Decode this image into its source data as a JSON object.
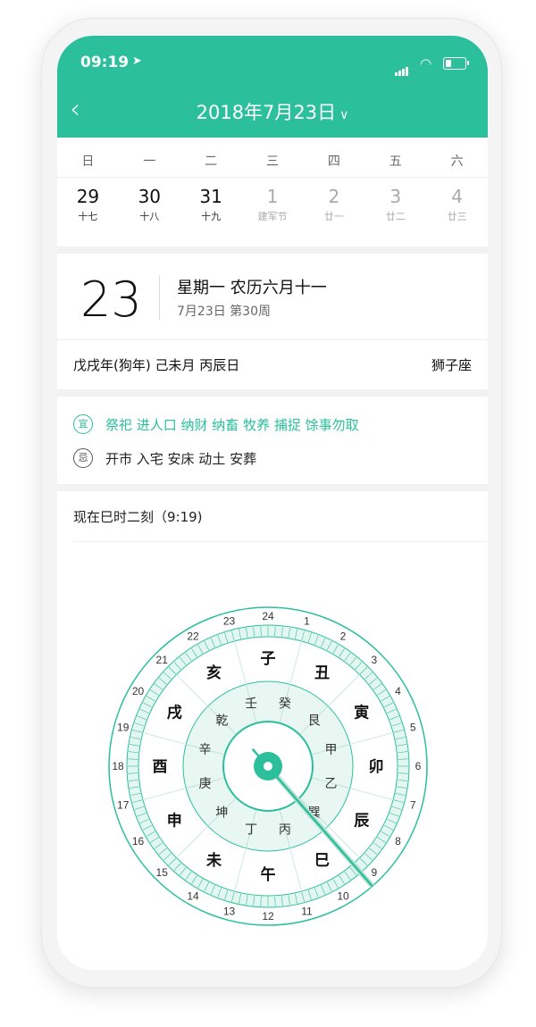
{
  "status": {
    "time": "09:19"
  },
  "header": {
    "title": "2018年7月23日"
  },
  "week": {
    "headers": [
      "日",
      "一",
      "二",
      "三",
      "四",
      "五",
      "六"
    ],
    "days": [
      {
        "num": "29",
        "lunar": "十七",
        "dim": false
      },
      {
        "num": "30",
        "lunar": "十八",
        "dim": false
      },
      {
        "num": "31",
        "lunar": "十九",
        "dim": false
      },
      {
        "num": "1",
        "lunar": "建军节",
        "dim": true
      },
      {
        "num": "2",
        "lunar": "廿一",
        "dim": true
      },
      {
        "num": "3",
        "lunar": "廿二",
        "dim": true
      },
      {
        "num": "4",
        "lunar": "廿三",
        "dim": true
      }
    ]
  },
  "detail": {
    "day": "23",
    "weekday_lunar": "星期一 农历六月十一",
    "sub": "7月23日 第30周",
    "ganzhi": "戊戌年(狗年) 己未月 丙辰日",
    "zodiac": "狮子座"
  },
  "yiji": {
    "yi_badge": "宜",
    "yi_text": "祭祀 进人口 纳财 纳畜 牧养 捕捉 馀事勿取",
    "ji_badge": "忌",
    "ji_text": "开市 入宅 安床 动土 安葬"
  },
  "now": {
    "text": "现在巳时二刻（9:19)"
  },
  "compass": {
    "hours": [
      "24",
      "1",
      "2",
      "3",
      "4",
      "5",
      "6",
      "7",
      "8",
      "9",
      "10",
      "11",
      "12",
      "13",
      "14",
      "15",
      "16",
      "17",
      "18",
      "19",
      "20",
      "21",
      "22",
      "23"
    ],
    "branches": [
      "子",
      "丑",
      "寅",
      "卯",
      "辰",
      "巳",
      "午",
      "未",
      "申",
      "酉",
      "戌",
      "亥"
    ],
    "stems": [
      "癸",
      "艮",
      "甲",
      "乙",
      "巽",
      "丙",
      "丁",
      "坤",
      "庚",
      "辛",
      "乾",
      "壬"
    ],
    "accent": "#2bbf9c"
  }
}
